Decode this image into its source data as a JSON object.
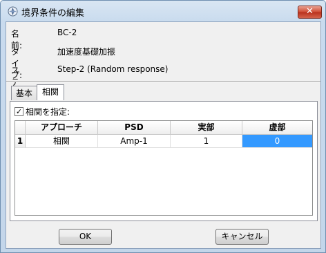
{
  "window": {
    "title": "境界条件の編集",
    "close_glyph": "✕"
  },
  "fields": [
    {
      "label": "名前:",
      "value": "BC-2"
    },
    {
      "label": "タイプ:",
      "value": "加速度基礎加振"
    },
    {
      "label": "ステップ:",
      "value": "Step-2 (Random response)"
    }
  ],
  "tabs": [
    {
      "label": "基本",
      "active": false
    },
    {
      "label": "相関",
      "active": true
    }
  ],
  "correlation": {
    "checkbox_label": "相関を指定:",
    "checked": true,
    "check_glyph": "✓"
  },
  "table": {
    "headers": [
      "アプローチ",
      "PSD",
      "実部",
      "虚部"
    ],
    "rows": [
      {
        "index": "1",
        "cells": [
          "相関",
          "Amp-1",
          "1",
          "0"
        ]
      }
    ],
    "selected_cell": "row 1, 虚部"
  },
  "buttons": {
    "ok": "OK",
    "cancel": "キャンセル"
  },
  "colors": {
    "selection": "#3399ff",
    "close": "#cf4b33",
    "frame": "#c9dbee"
  }
}
